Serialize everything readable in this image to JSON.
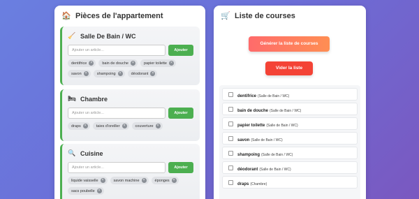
{
  "left_panel": {
    "title": "Pièces de l'appartement",
    "icon": "house-icon",
    "rooms": [
      {
        "name": "Salle De Bain / WC",
        "icon": "broom-icon",
        "input_placeholder": "Ajouter un article...",
        "add_label": "Ajouter",
        "tags": [
          "dentifrice",
          "bain de douche",
          "papier toilette",
          "savon",
          "shampoing",
          "déodorant"
        ]
      },
      {
        "name": "Chambre",
        "icon": "bed-icon",
        "input_placeholder": "Ajouter un article...",
        "add_label": "Ajouter",
        "tags": [
          "draps",
          "taies d'oreiller",
          "couverture"
        ]
      },
      {
        "name": "Cuisine",
        "icon": "magnifier-icon",
        "input_placeholder": "Ajouter un article...",
        "add_label": "Ajouter",
        "tags": [
          "liquide vaisselle",
          "savon machine",
          "éponges",
          "sacs poubelle"
        ]
      }
    ]
  },
  "right_panel": {
    "title": "Liste de courses",
    "icon": "cart-icon",
    "generate_label": "Générer la liste de courses",
    "clear_label": "Vider la liste",
    "items": [
      {
        "name": "dentifrice",
        "room": "(Salle de Bain / WC)"
      },
      {
        "name": "bain de douche",
        "room": "(Salle de Bain / WC)"
      },
      {
        "name": "papier toilette",
        "room": "(Salle de Bain / WC)"
      },
      {
        "name": "savon",
        "room": "(Salle de Bain / WC)"
      },
      {
        "name": "shampoing",
        "room": "(Salle de Bain / WC)"
      },
      {
        "name": "déodorant",
        "room": "(Salle de Bain / WC)"
      },
      {
        "name": "draps",
        "room": "(Chambre)"
      }
    ]
  },
  "colors": {
    "accent_green": "#4caf50",
    "clear_red": "#f44336",
    "generate_gradient_start": "#ff6b6b",
    "generate_gradient_end": "#ff8e53"
  }
}
